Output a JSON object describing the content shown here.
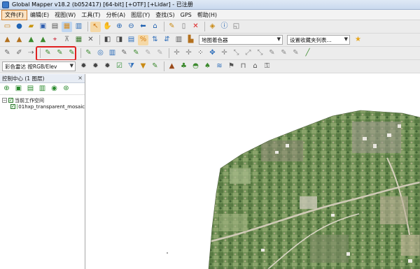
{
  "window": {
    "title": "Global Mapper v18.2 (b052417) [64-bit] [+OTF] [+Lidar] - 已注册"
  },
  "menu": [
    {
      "label": "文件(F)",
      "active": true
    },
    {
      "label": "编辑(E)"
    },
    {
      "label": "视图(W)"
    },
    {
      "label": "工具(T)"
    },
    {
      "label": "分析(A)"
    },
    {
      "label": "图层(Y)"
    },
    {
      "label": "查找(S)"
    },
    {
      "label": "GPS"
    },
    {
      "label": "帮助(H)"
    }
  ],
  "toolbar2": {
    "shader_select": "地图着色器",
    "favorites_select": "设置收藏夹列表..."
  },
  "toolbar4": {
    "elevation_select": "彩色雷达 按RGB/Elev"
  },
  "control_center": {
    "title": "控制中心 (1 图层)",
    "close_glyph": "×",
    "tree": {
      "workspace": "当前工作空间",
      "layer": "01hxp_transparent_mosaic"
    }
  },
  "icons": {
    "row1": [
      "new-icon",
      "globe-icon",
      "open-icon",
      "save-icon",
      "print-icon",
      "layers-icon",
      "config-icon",
      "select-icon",
      "pan-icon",
      "zoom-in-icon",
      "zoom-out-icon",
      "back-icon",
      "home-icon",
      "pencil-icon",
      "page-icon",
      "delete-icon",
      "tag-icon",
      "info-icon",
      "window-icon"
    ],
    "row2": [
      "terrain-a-icon",
      "terrain-b-icon",
      "terrain-c-icon",
      "terrain-d-icon",
      "pin-icon",
      "marker-icon",
      "grid-icon",
      "close-x-icon",
      "view3d-a-icon",
      "view3d-b-icon",
      "view3d-c-icon",
      "percent-icon",
      "sort-a-icon",
      "sort-b-icon",
      "ruler-icon",
      "shade-icon",
      "star-icon"
    ],
    "row3": [
      "pen-a-icon",
      "pen-b-icon",
      "pen-c-icon",
      "digitize-a-icon",
      "digitize-b-icon",
      "digitize-c-icon",
      "digitize-d-icon",
      "target-icon",
      "chart-icon",
      "vertex-a-icon",
      "vertex-b-icon",
      "vertex-c-icon",
      "move-icon",
      "node-a-icon",
      "node-b-icon",
      "node-c-icon",
      "node-d-icon",
      "line-a-icon",
      "line-b-icon",
      "line-c-icon",
      "line-d-icon",
      "line-e-icon",
      "line-f-icon",
      "line-g-icon",
      "line-h-icon"
    ],
    "row4": [
      "settings-a-icon",
      "settings-b-icon",
      "settings-c-icon",
      "check-icon",
      "funnel-icon",
      "brush-icon",
      "mountain-icon",
      "trees-icon",
      "hill-icon",
      "tree-icon",
      "water-icon",
      "flag-icon",
      "bridge-icon",
      "house-icon",
      "key-icon"
    ],
    "panel": [
      "add-layer-icon",
      "remove-layer-icon",
      "up-layer-icon",
      "down-layer-icon",
      "options-icon",
      "refresh-icon"
    ]
  }
}
